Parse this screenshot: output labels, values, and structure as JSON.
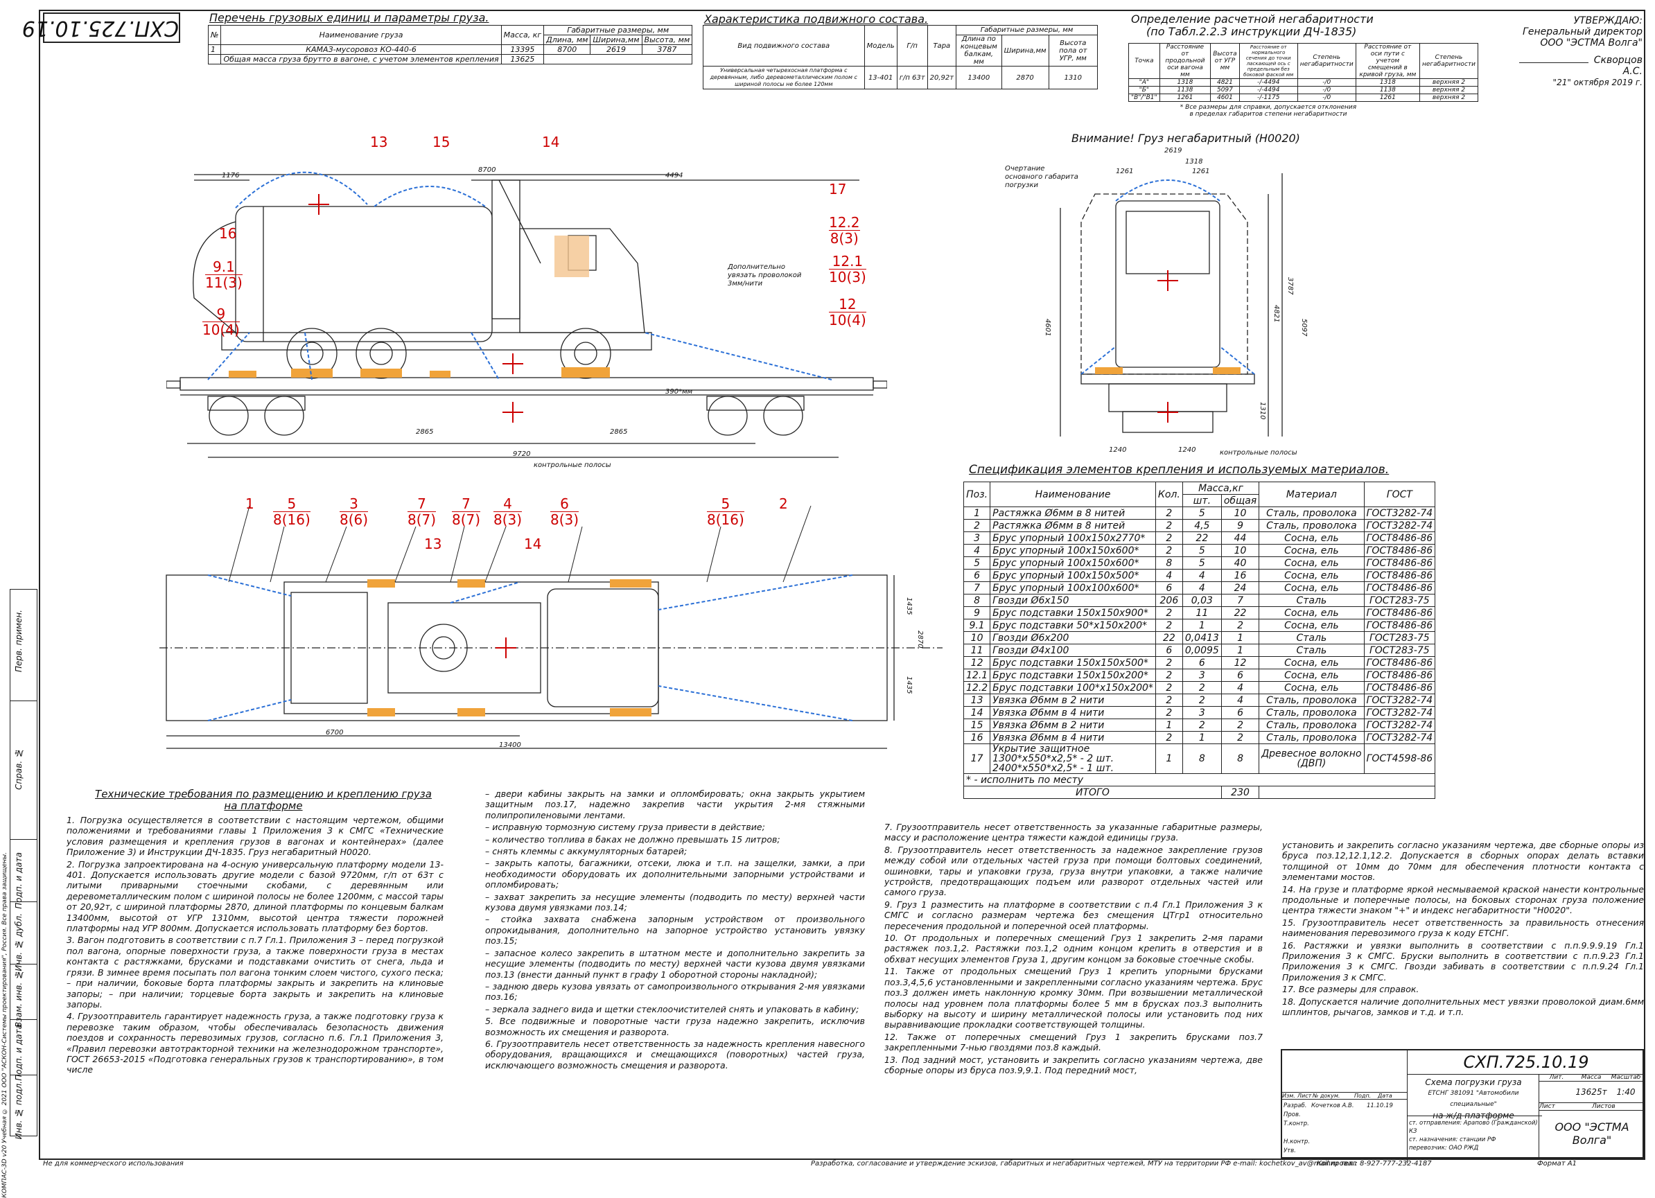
{
  "doc_code": "СХП.725.10.19",
  "cargo_title": "Перечень грузовых единиц и параметры груза.",
  "cargo_table": {
    "h_no": "№",
    "h_name": "Наименование груза",
    "h_mass": "Масса, кг",
    "h_dims": "Габаритные размеры, мм",
    "h_len": "Длина, мм",
    "h_wid": "Ширина,мм",
    "h_hgt": "Высота, мм",
    "rows": [
      {
        "no": "1",
        "name": "КАМАЗ-мусоровоз КО-440-6",
        "mass": "13395",
        "len": "8700",
        "wid": "2619",
        "hgt": "3787"
      },
      {
        "no": "",
        "name": "Общая масса груза брутто в вагоне, с учетом элементов крепления",
        "mass": "13625",
        "len": "",
        "wid": "",
        "hgt": ""
      }
    ]
  },
  "wagon_title": "Характеристика подвижного состава.",
  "wagon_table": {
    "h_kind": "Вид подвижного состава",
    "h_model": "Модель",
    "h_gp": "Г/п",
    "h_tara": "Тара",
    "h_gab": "Габаритные размеры, мм",
    "h_len": "Длина по концевым балкам, мм",
    "h_wid": "Ширина,мм",
    "h_hgt": "Высота пола от УГР, мм",
    "kind": "Универсальная четырехосная платформа с деревянным, либо деревометаллическим полом с шириной полосы не более 120мм",
    "model": "13-401",
    "gp": "г/п 63т",
    "tara": "20,92т",
    "len": "13400",
    "wid": "2870",
    "hgt": "1310"
  },
  "gab_title_1": "Определение расчетной негабаритности",
  "gab_title_2": "(по Табл.2.2.3 инструкции ДЧ-1835)",
  "gab_table": {
    "headers": [
      "Точка",
      "Расстояние от продольной оси вагона мм",
      "Высота от УГР мм",
      "Расстояние от нормального сечения до точки ласкающей ось с предельным без боковой фаской мм",
      "Степень негабаритности",
      "Расстояние от оси пути с учетом смещений в кривой груза, мм",
      "Степень негабаритности"
    ],
    "rows": [
      {
        "p": "\"А\"",
        "a": "1318",
        "b": "4821",
        "c": "-/-4494",
        "d": "-/0",
        "e": "1318",
        "f": "верхняя 2"
      },
      {
        "p": "\"Б\"",
        "a": "1138",
        "b": "5097",
        "c": "-/-4494",
        "d": "-/0",
        "e": "1138",
        "f": "верхняя 2"
      },
      {
        "p": "\"В\"/\"В1\"",
        "a": "1261",
        "b": "4601",
        "c": "-/-1175",
        "d": "-/0",
        "e": "1261",
        "f": "верхняя 2"
      }
    ],
    "note": "* Все размеры для справки, допускается отклонения в пределах габаритов степени негабаритности"
  },
  "approve": {
    "l1": "УТВЕРЖДАЮ:",
    "l2": "Генеральный директор",
    "l3": "ООО \"ЭСТМА Волга\"",
    "l4": "Скворцов А.С.",
    "l5": "\"21\" октября 2019 г."
  },
  "warning": "Внимание! Груз негабаритный (Н0020)",
  "spec_title": "Спецификация элементов крепления и используемых материалов.",
  "spec_table": {
    "h_pos": "Поз.",
    "h_name": "Наименование",
    "h_qty": "Кол.",
    "h_mass": "Масса,кг",
    "h_one": "шт.",
    "h_all": "общая",
    "h_mat": "Материал",
    "h_gost": "ГОСТ",
    "rows": [
      {
        "pos": "1",
        "name": "Растяжка Ø6мм в 8 нитей",
        "qty": "2",
        "one": "5",
        "all": "10",
        "mat": "Сталь, проволока",
        "gost": "ГОСТ3282-74"
      },
      {
        "pos": "2",
        "name": "Растяжка Ø6мм в 8 нитей",
        "qty": "2",
        "one": "4,5",
        "all": "9",
        "mat": "Сталь, проволока",
        "gost": "ГОСТ3282-74"
      },
      {
        "pos": "3",
        "name": "Брус упорный 100х150х2770*",
        "qty": "2",
        "one": "22",
        "all": "44",
        "mat": "Сосна, ель",
        "gost": "ГОСТ8486-86"
      },
      {
        "pos": "4",
        "name": "Брус упорный 100х150х600*",
        "qty": "2",
        "one": "5",
        "all": "10",
        "mat": "Сосна, ель",
        "gost": "ГОСТ8486-86"
      },
      {
        "pos": "5",
        "name": "Брус упорный 100х150х600*",
        "qty": "8",
        "one": "5",
        "all": "40",
        "mat": "Сосна, ель",
        "gost": "ГОСТ8486-86"
      },
      {
        "pos": "6",
        "name": "Брус упорный 100х150х500*",
        "qty": "4",
        "one": "4",
        "all": "16",
        "mat": "Сосна, ель",
        "gost": "ГОСТ8486-86"
      },
      {
        "pos": "7",
        "name": "Брус упорный 100х100х600*",
        "qty": "6",
        "one": "4",
        "all": "24",
        "mat": "Сосна, ель",
        "gost": "ГОСТ8486-86"
      },
      {
        "pos": "8",
        "name": "Гвозди Ø6х150",
        "qty": "206",
        "one": "0,03",
        "all": "7",
        "mat": "Сталь",
        "gost": "ГОСТ283-75"
      },
      {
        "pos": "9",
        "name": "Брус подставки 150х150х900*",
        "qty": "2",
        "one": "11",
        "all": "22",
        "mat": "Сосна, ель",
        "gost": "ГОСТ8486-86"
      },
      {
        "pos": "9.1",
        "name": "Брус подставки 50*х150х200*",
        "qty": "2",
        "one": "1",
        "all": "2",
        "mat": "Сосна, ель",
        "gost": "ГОСТ8486-86"
      },
      {
        "pos": "10",
        "name": "Гвозди Ø6х200",
        "qty": "22",
        "one": "0,0413",
        "all": "1",
        "mat": "Сталь",
        "gost": "ГОСТ283-75"
      },
      {
        "pos": "11",
        "name": "Гвозди Ø4х100",
        "qty": "6",
        "one": "0,0095",
        "all": "1",
        "mat": "Сталь",
        "gost": "ГОСТ283-75"
      },
      {
        "pos": "12",
        "name": "Брус подставки 150х150х500*",
        "qty": "2",
        "one": "6",
        "all": "12",
        "mat": "Сосна, ель",
        "gost": "ГОСТ8486-86"
      },
      {
        "pos": "12.1",
        "name": "Брус подставки 150х150х200*",
        "qty": "2",
        "one": "3",
        "all": "6",
        "mat": "Сосна, ель",
        "gost": "ГОСТ8486-86"
      },
      {
        "pos": "12.2",
        "name": "Брус подставки 100*х150х200*",
        "qty": "2",
        "one": "2",
        "all": "4",
        "mat": "Сосна, ель",
        "gost": "ГОСТ8486-86"
      },
      {
        "pos": "13",
        "name": "Увязка Ø6мм в 2 нити",
        "qty": "2",
        "one": "2",
        "all": "4",
        "mat": "Сталь, проволока",
        "gost": "ГОСТ3282-74"
      },
      {
        "pos": "14",
        "name": "Увязка Ø6мм в 4 нити",
        "qty": "2",
        "one": "3",
        "all": "6",
        "mat": "Сталь, проволока",
        "gost": "ГОСТ3282-74"
      },
      {
        "pos": "15",
        "name": "Увязка Ø6мм в 2 нити",
        "qty": "1",
        "one": "2",
        "all": "2",
        "mat": "Сталь, проволока",
        "gost": "ГОСТ3282-74"
      },
      {
        "pos": "16",
        "name": "Увязка Ø6мм в 4 нити",
        "qty": "2",
        "one": "1",
        "all": "2",
        "mat": "Сталь, проволока",
        "gost": "ГОСТ3282-74"
      }
    ],
    "row17": {
      "pos": "17",
      "name1": "Укрытие защитное",
      "name2": "1300*х550*х2,5* - 2 шт.",
      "name3": "2400*х550*х2,5* - 1 шт.",
      "qty": "1",
      "one": "8",
      "all": "8",
      "mat1": "Древесное волокно",
      "mat2": "(ДВП)",
      "gost": "ГОСТ4598-86"
    },
    "note": "* - исполнить по месту",
    "total_label": "ИТОГО",
    "total": "230"
  },
  "callouts": [
    {
      "num": "13",
      "den": ""
    },
    {
      "num": "15",
      "den": ""
    },
    {
      "num": "14",
      "den": ""
    },
    {
      "num": "17",
      "den": ""
    },
    {
      "num": "16",
      "den": ""
    },
    {
      "num": "12.2",
      "den": "8(3)"
    },
    {
      "num": "9.1",
      "den": "11(3)"
    },
    {
      "num": "12.1",
      "den": "10(3)"
    },
    {
      "num": "9",
      "den": "10(4)"
    },
    {
      "num": "12",
      "den": "10(4)"
    },
    {
      "num": "1",
      "den": ""
    },
    {
      "num": "5",
      "den": "8(16)"
    },
    {
      "num": "3",
      "den": "8(6)"
    },
    {
      "num": "7",
      "den": "8(7)"
    },
    {
      "num": "7",
      "den": "8(7)"
    },
    {
      "num": "4",
      "den": "8(3)"
    },
    {
      "num": "6",
      "den": "8(3)"
    },
    {
      "num": "5",
      "den": "8(16)"
    },
    {
      "num": "2",
      "den": ""
    },
    {
      "num": "13",
      "den": ""
    },
    {
      "num": "14",
      "den": ""
    }
  ],
  "dims": {
    "d8700": "8700",
    "d4494": "4494",
    "d1176": "1176",
    "d9720": "9720",
    "d2865a": "2865",
    "d2865b": "2865",
    "d390": "390*мм",
    "d13400": "13400",
    "d6700": "6700",
    "d2870": "2870",
    "d1435a": "1435",
    "d1435b": "1435",
    "d2619": "2619",
    "d1318": "1318",
    "d1261a": "1261",
    "d1261b": "1261",
    "d3787": "3787",
    "d5097": "5097",
    "d4821": "4821",
    "d4601": "4601",
    "d1310": "1310",
    "d1240a": "1240",
    "d1240b": "1240",
    "ctrl_strip": "контрольные полосы",
    "ctrl_strip2": "контрольные полосы",
    "contour": "Очертание основного габарита погрузки",
    "extra_tie": "Дополнительно увязать проволокой 3мм/нити"
  },
  "tech_title": "Технические требования по размещению и креплению груза на платформе",
  "tech_col1": [
    "1. Погрузка осуществляется в соответствии с настоящим чертежом, общими положениями и требованиями главы 1 Приложения 3 к СМГС «Технические условия размещения и крепления грузов в вагонах и контейнерах» (далее Приложение 3) и Инструкции ДЧ-1835. Груз негабаритный Н0020.",
    "2. Погрузка запроектирована на 4-осную универсальную платформу модели 13-401. Допускается использовать другие модели с базой 9720мм, г/п от 63т с литыми приварными стоечными скобами, с деревянным или деревометаллическим полом с шириной полосы не более 1200мм, с массой тары от 20,92т, с шириной платформы 2870, длиной платформы по концевым балкам 13400мм, высотой от УГР 1310мм, высотой центра тяжести порожней платформы над УГР 800мм. Допускается использовать платформу без бортов.",
    "3. Вагон подготовить в соответствии с п.7 Гл.1. Приложения 3 – перед погрузкой пол вагона, опорные поверхности груза, а также поверхности груза в местах контакта с растяжками, брусками и подставками очистить от снега, льда и грязи. В зимнее время посыпать пол вагона тонким слоем чистого, сухого песка; – при наличии, боковые борта платформы закрыть и закрепить на клиновые запоры; – при наличии; торцевые борта закрыть и закрепить на клиновые запоры.",
    "4. Грузоотправитель гарантирует надежность груза, а также подготовку груза к перевозке таким образом, чтобы обеспечивалась безопасность движения поездов и сохранность перевозимых грузов, согласно п.6. Гл.1 Приложения 3, «Правил перевозки автотракторной техники на железнодорожном транспорте», ГОСТ 26653-2015 «Подготовка генеральных грузов к транспортированию», в том числе"
  ],
  "tech_col2": [
    "– двери кабины закрыть на замки и опломбировать; окна закрыть укрытием защитным поз.17, надежно закрепив части укрытия 2-мя стяжными полипропиленовыми лентами.",
    "– исправную тормозную систему груза привести в действие;",
    "– количество топлива в баках не должно превышать 15 литров;",
    "– снять клеммы с аккумуляторных батарей;",
    "– закрыть капоты, багажники, отсеки, люка и т.п. на защелки, замки, а при необходимости оборудовать их дополнительными запорными устройствами и опломбировать;",
    "– захват закрепить за несущие элементы (подводить по месту) верхней части кузова двумя увязками поз.14;",
    "– стойка захвата снабжена запорным устройством от произвольного опрокидывания, дополнительно на запорное устройство установить увязку поз.15;",
    "– запасное колесо закрепить в штатном месте и дополнительно закрепить за несущие элементы (подводить по месту) верхней части кузова двумя увязками поз.13 (внести данный пункт в графу 1 оборотной стороны накладной);",
    "– заднюю дверь кузова увязать от самопроизвольного открывания 2-мя увязками поз.16;",
    "– зеркала заднего вида и щетки стеклоочистителей снять и упаковать в кабину;",
    "5. Все подвижные и поворотные части груза надежно закрепить, исключив возможность их смещения и разворота.",
    "6. Грузоотправитель несет ответственность за надежность крепления навесного оборудования, вращающихся и смещающихся (поворотных) частей груза, исключающего возможность смещения и разворота."
  ],
  "tech_col3": [
    "7. Грузоотправитель несет ответственность за указанные габаритные размеры, массу и расположение центра тяжести каждой единицы груза.",
    "8. Грузоотправитель несет ответственность за надежное закрепление грузов между собой или отдельных частей груза при помощи болтовых соединений, ошиновки, тары и упаковки груза, груза внутри упаковки, а также наличие устройств, предотвращающих подъем или разворот отдельных частей или самого груза.",
    "9. Груз 1 разместить на платформе в соответствии с п.4 Гл.1 Приложения 3 к СМГС и согласно размерам чертежа без смещения ЦТгр1 относительно пересечения продольной и поперечной осей платформы.",
    "10. От продольных и поперечных смещений Груз 1 закрепить 2-мя парами растяжек поз.1,2. Растяжки поз.1,2 одним концом крепить в отверстия и в обхват несущих элементов Груза 1, другим концом за боковые стоечные скобы.",
    "11. Также от продольных смещений Груз 1 крепить упорными брусками поз.3,4,5,6 установленными и закрепленными согласно указаниям чертежа. Брус поз.3 должен иметь наклонную кромку 30мм. При возвышении металлической полосы над уровнем пола платформы более 5 мм в брусках поз.3 выполнить выборку на высоту и ширину металлической полосы или установить под них выравнивающие прокладки соответствующей толщины.",
    "12. Также от поперечных смещений Груз 1 закрепить брусками поз.7 закрепленными 7-нью гвоздями поз.8 каждый.",
    "13. Под задний мост, установить и закрепить согласно указаниям чертежа, две сборные опоры из бруса поз.9,9.1. Под передний мост,"
  ],
  "tech_col4": [
    "установить и закрепить согласно указаниям чертежа, две сборные опоры из бруса поз.12,12.1,12.2. Допускается в сборных опорах делать вставки толщиной от 10мм до 70мм для обеспечения плотности контакта с элементами мостов.",
    "14. На грузе и платформе яркой несмываемой краской нанести контрольные продольные и поперечные полосы, на боковых сторонах груза положение центра тяжести знаком \"+\" и индекс негабаритности \"Н0020\".",
    "15. Грузоотправитель несет ответственность за правильность отнесения наименования перевозимого груза к коду ЕТСНГ.",
    "16. Растяжки и увязки выполнить в соответствии с п.п.9.9.9.19 Гл.1 Приложения 3 к СМГС. Бруски выполнить в соответствии с п.п.9.23 Гл.1 Приложения 3 к СМГС. Гвозди забивать в соответствии с п.п.9.24 Гл.1 Приложения 3 к СМГС.",
    "17. Все размеры для справок.",
    "18. Допускается наличие дополнительных мест увязки проволокой диам.6мм шплинтов, рычагов, замков и т.д. и т.п."
  ],
  "titleblock": {
    "code": "СХП.725.10.19",
    "name1": "Схема погрузки груза",
    "name2": "ЕТСНГ 381091 \"Автомобили специальные\"",
    "name3": "на ж/д платформе",
    "lit": "Лит.",
    "mass_h": "Масса",
    "scale_h": "Масштаб",
    "mass": "13625т",
    "scale": "1:40",
    "sheet": "Лист",
    "sheets": "Листов",
    "company": "ООО \"ЭСТМА Волга\"",
    "st_from": "ст. отправления: Арапово (Гражданской) КЗ",
    "st_to": "ст. назначения: станции РФ",
    "carrier": "перевозчик: ОАО РЖД",
    "r_izm": "Изм.",
    "r_list": "Лист",
    "r_ndoc": "№ докум.",
    "r_podp": "Подп.",
    "r_data": "Дата",
    "r_razrab": "Разраб.",
    "r_razrab_name": "Кочетков А.В.",
    "r_date": "11.10.19",
    "r_prov": "Пров.",
    "r_tkontr": "Т.контр.",
    "r_nkontr": "Н.контр.",
    "r_utv": "Утв."
  },
  "side": {
    "s1": "Перв. примен.",
    "s2": "Справ. №",
    "s3": "Подп. и дата",
    "s4": "Инв. № дубл.",
    "s5": "Взам. инв. №",
    "s6": "Подп. и дата",
    "s7": "Инв. № подл.",
    "copyright": "КОМПАС-3D v20 Учебная © 2021 ООО \"АСКОН-Системы проектирования\", Россия. Все права защищены."
  },
  "footer": {
    "left": "Не для коммерческого использования",
    "center": "Разработка, согласование и утверждение эскизов, габаритных и негабаритных чертежей, МТУ на территории РФ     e-mail: kochetkov_av@mail.ru тел.: 8-927-777-232-4187",
    "copied": "Копировал",
    "format": "Формат   А1"
  }
}
